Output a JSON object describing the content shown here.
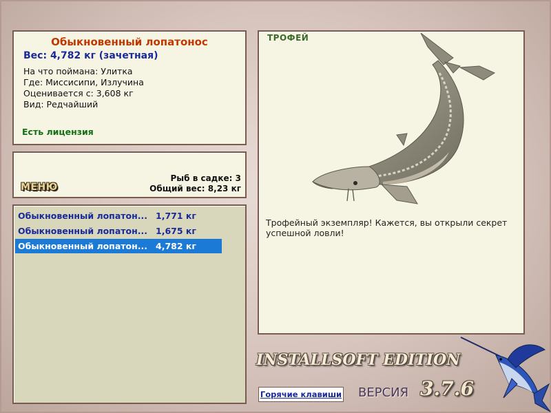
{
  "info": {
    "title": "Обыкновенный лопатонос",
    "weight": "Вес: 4,782 кг (зачетная)",
    "lines": [
      "На что поймана: Улитка",
      "Где: Миссисипи, Излучина",
      "Оценивается с: 3,608 кг",
      "Вид: Редчайший"
    ],
    "license": "Есть лицензия"
  },
  "menu": {
    "button_label": "МЕНЮ",
    "fish_count": "Рыб в садке: 3",
    "total_weight": "Общий вес: 8,23 кг"
  },
  "catch_list": [
    {
      "name": "Обыкновенный лопатон...",
      "weight": "1,771 кг",
      "selected": false
    },
    {
      "name": "Обыкновенный лопатон...",
      "weight": "1,675 кг",
      "selected": false
    },
    {
      "name": "Обыкновенный лопатон...",
      "weight": "4,782 кг",
      "selected": true
    }
  ],
  "trophy": {
    "label": "ТРОФЕЙ",
    "description": "Трофейный экземпляр! Кажется, вы открыли секрет успешной ловли!",
    "image": "paddlefish-image"
  },
  "footer": {
    "edition": "INSTALLSOFT EDITION",
    "hotkeys_label": "Горячие клавиши",
    "version_label": "ВЕРСИЯ",
    "version_number": "3.7.6",
    "logo": "marlin-logo"
  },
  "colors": {
    "panel_bg": "#f6f5e4",
    "list_bg": "#d8d7bc",
    "panel_border": "#7a5b50",
    "title": "#c03800",
    "weight": "#1a2a9a",
    "license": "#157015",
    "selection": "#1a7ad6"
  }
}
